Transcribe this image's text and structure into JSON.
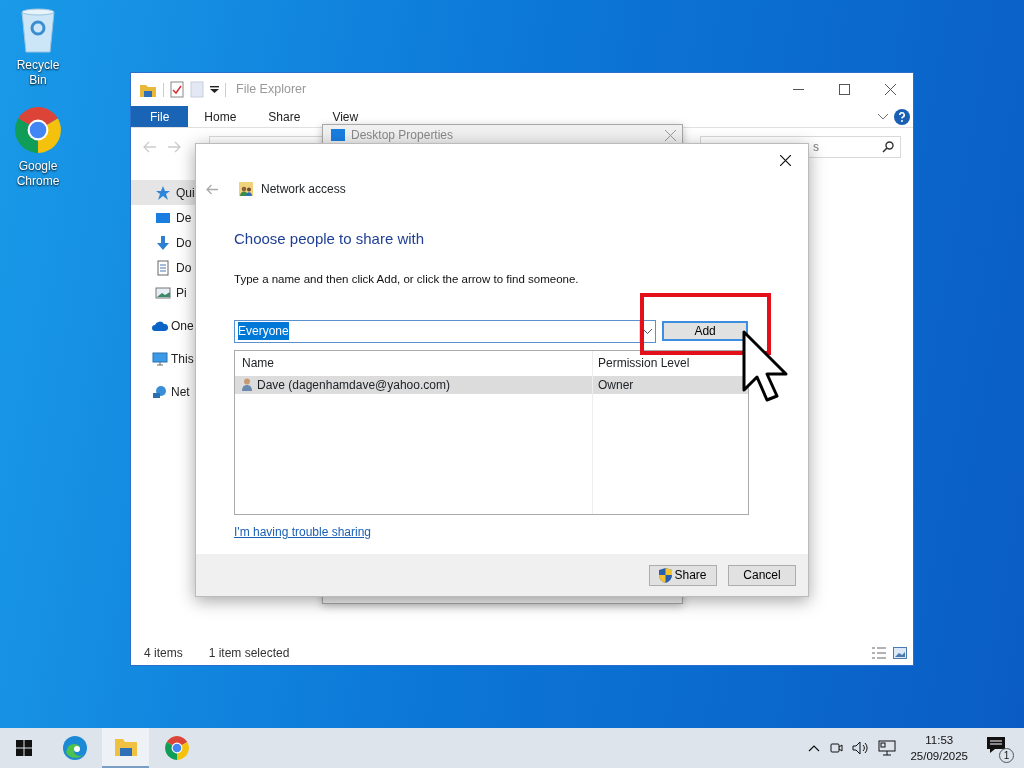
{
  "desktop": {
    "icons": [
      {
        "kind": "recycle",
        "label": "Recycle Bin"
      },
      {
        "kind": "chrome",
        "label": "Google Chrome"
      }
    ]
  },
  "explorer": {
    "title": "File Explorer",
    "ribbon_tabs": [
      {
        "label": "File",
        "selected": true
      },
      {
        "label": "Home",
        "selected": false
      },
      {
        "label": "Share",
        "selected": false
      },
      {
        "label": "View",
        "selected": false
      }
    ],
    "search": {
      "placeholder": "s"
    },
    "nav_items": [
      {
        "kind": "star",
        "label": "Qui",
        "selected": true
      },
      {
        "kind": "desktop",
        "label": "De",
        "selected": false
      },
      {
        "kind": "download",
        "label": "Do",
        "selected": false
      },
      {
        "kind": "document",
        "label": "Do",
        "selected": false
      },
      {
        "kind": "pictures",
        "label": "Pi",
        "selected": false
      },
      {
        "kind": "cloud",
        "label": "One",
        "selected": false
      },
      {
        "kind": "pc",
        "label": "This",
        "selected": false
      },
      {
        "kind": "network",
        "label": "Net",
        "selected": false
      }
    ],
    "status_bar": {
      "count": "4 items",
      "selection": "1 item selected"
    }
  },
  "properties_window": {
    "title": "Desktop Properties"
  },
  "dialog": {
    "title": "Network access",
    "heading": "Choose people to share with",
    "instruction": "Type a name and then click Add, or click the arrow to find someone.",
    "name_field": {
      "value": "Everyone",
      "text_selected": true
    },
    "add_button": "Add",
    "columns": [
      "Name",
      "Permission Level"
    ],
    "rows": [
      {
        "name": "Dave (dagenhamdave@yahoo.com)",
        "permission": "Owner",
        "selected": true
      }
    ],
    "help_link": "I'm having trouble sharing",
    "buttons": [
      {
        "kind": "shield",
        "label": "Share"
      },
      {
        "kind": "plain",
        "label": "Cancel"
      }
    ]
  },
  "taskbar": {
    "apps": [
      {
        "kind": "edge",
        "active": false
      },
      {
        "kind": "explorer",
        "active": true
      },
      {
        "kind": "chrome",
        "active": false
      }
    ],
    "time": "11:53",
    "date": "25/09/2025",
    "notifications": "1"
  }
}
